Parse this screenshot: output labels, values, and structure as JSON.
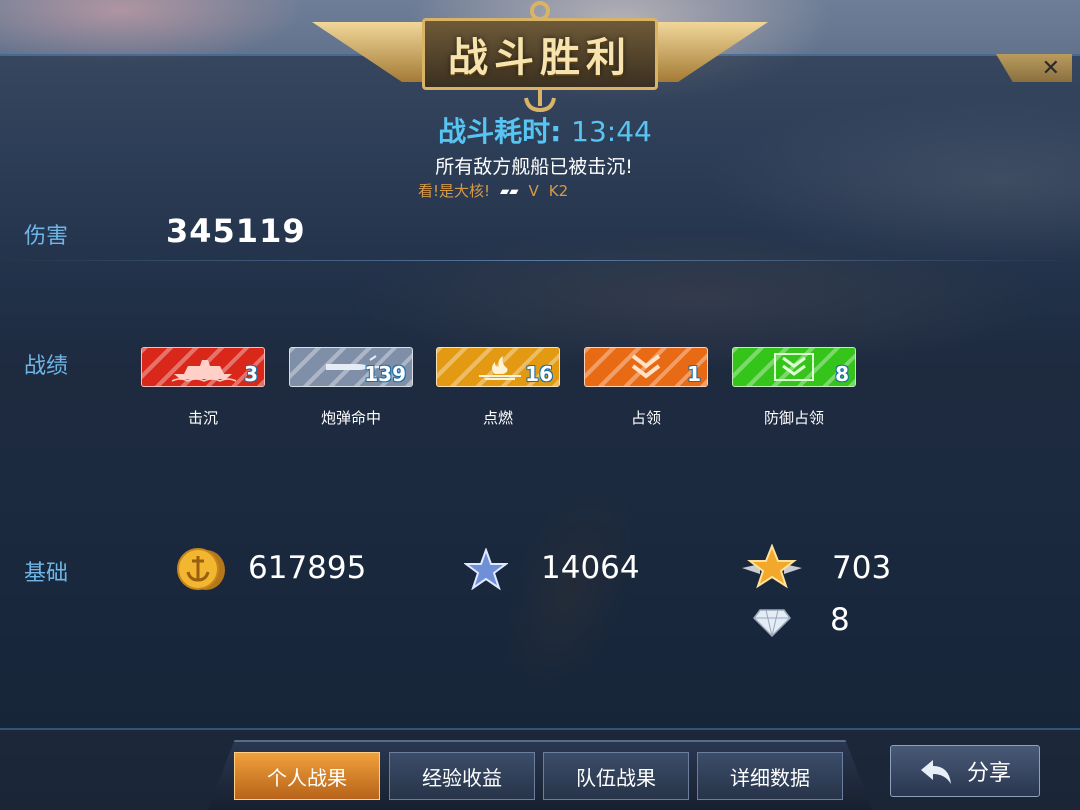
{
  "title": "战斗胜利",
  "duration": {
    "label": "战斗耗时:",
    "value": "13:44"
  },
  "result_message": "所有敌方舰船已被击沉!",
  "chat": {
    "message": "看!是大核!",
    "arrow": "▰▰",
    "v": "V",
    "name": "K2"
  },
  "damage": {
    "label": "伤害",
    "value": "345119"
  },
  "record": {
    "label": "战绩",
    "items": [
      {
        "label": "击沉",
        "count": "3",
        "color": "#d9281a",
        "icon": "ship-sunk-icon"
      },
      {
        "label": "炮弹命中",
        "count": "139",
        "color": "#7f8fa8",
        "icon": "shell-hit-icon"
      },
      {
        "label": "点燃",
        "count": "16",
        "color": "#e39a12",
        "icon": "fire-icon"
      },
      {
        "label": "占领",
        "count": "1",
        "color": "#e86a14",
        "icon": "capture-chevron-icon"
      },
      {
        "label": "防御占领",
        "count": "8",
        "color": "#34c41a",
        "icon": "defend-capture-icon"
      }
    ]
  },
  "base": {
    "label": "基础",
    "gold": "617895",
    "exp": "14064",
    "rank_points": "703",
    "diamond": "8"
  },
  "close_icon": "close-icon",
  "tabs": [
    "个人战果",
    "经验收益",
    "队伍战果",
    "详细数据"
  ],
  "active_tab": 0,
  "share_label": "分享"
}
